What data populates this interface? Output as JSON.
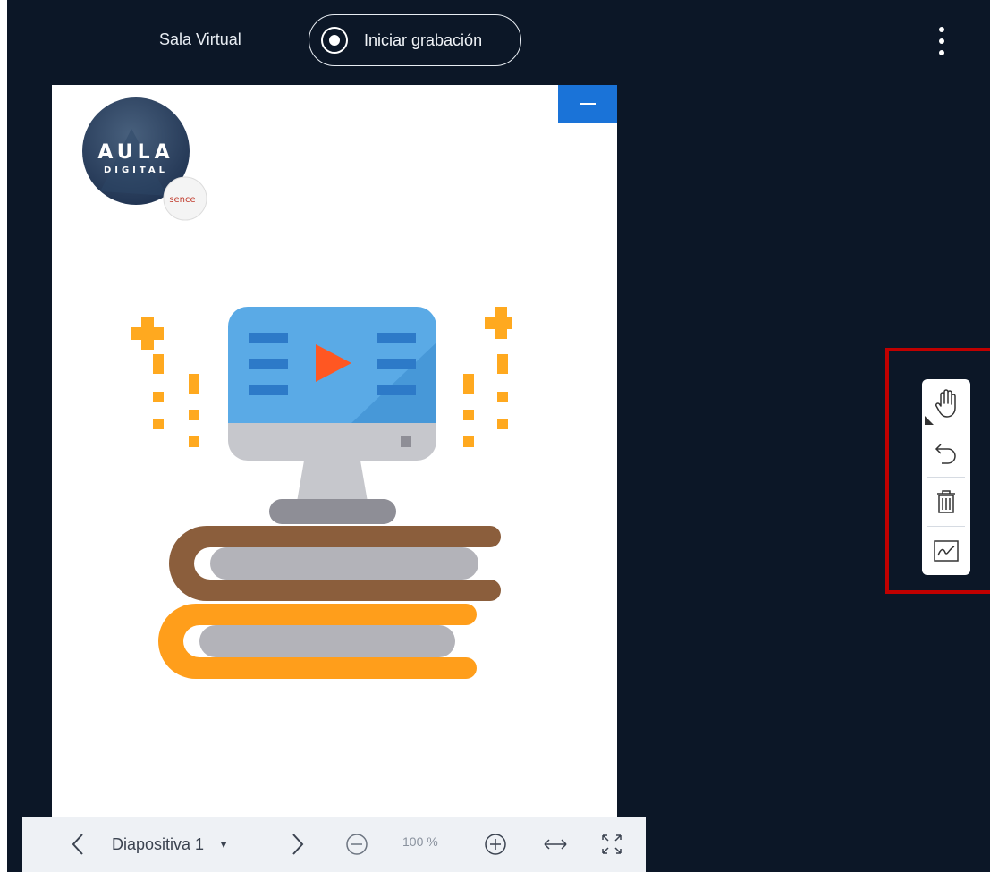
{
  "header": {
    "room_name": "Sala Virtual",
    "record_button_label": "Iniciar grabación",
    "options_icon": "kebab-menu-icon"
  },
  "slide": {
    "logo": {
      "brand_top": "AULA",
      "brand_bottom": "DIGITAL",
      "badge": "sence"
    },
    "illustration": "monitor-video-on-books",
    "minimize_icon": "minus-icon"
  },
  "presentation_toolbar": {
    "prev_icon": "chevron-left-icon",
    "slide_label": "Diapositiva 1",
    "slide_select_icon": "caret-down-icon",
    "next_icon": "chevron-right-icon",
    "zoom_out_icon": "zoom-out-icon",
    "zoom_level": "100 %",
    "zoom_in_icon": "zoom-in-icon",
    "fit_width_icon": "fit-width-icon",
    "fullscreen_icon": "fullscreen-icon"
  },
  "annotation_tools": [
    {
      "name": "hand-tool",
      "icon": "hand-icon"
    },
    {
      "name": "undo",
      "icon": "undo-icon"
    },
    {
      "name": "clear-all",
      "icon": "trash-icon"
    },
    {
      "name": "whiteboard-multiuser",
      "icon": "whiteboard-icon"
    }
  ],
  "colors": {
    "background": "#0c1727",
    "accent": "#1a73d8",
    "highlight": "#c00000",
    "book_brown": "#8b5e3c",
    "book_orange": "#ff9e1b",
    "monitor_blue": "#5aaae6",
    "play_red": "#ff5722"
  }
}
